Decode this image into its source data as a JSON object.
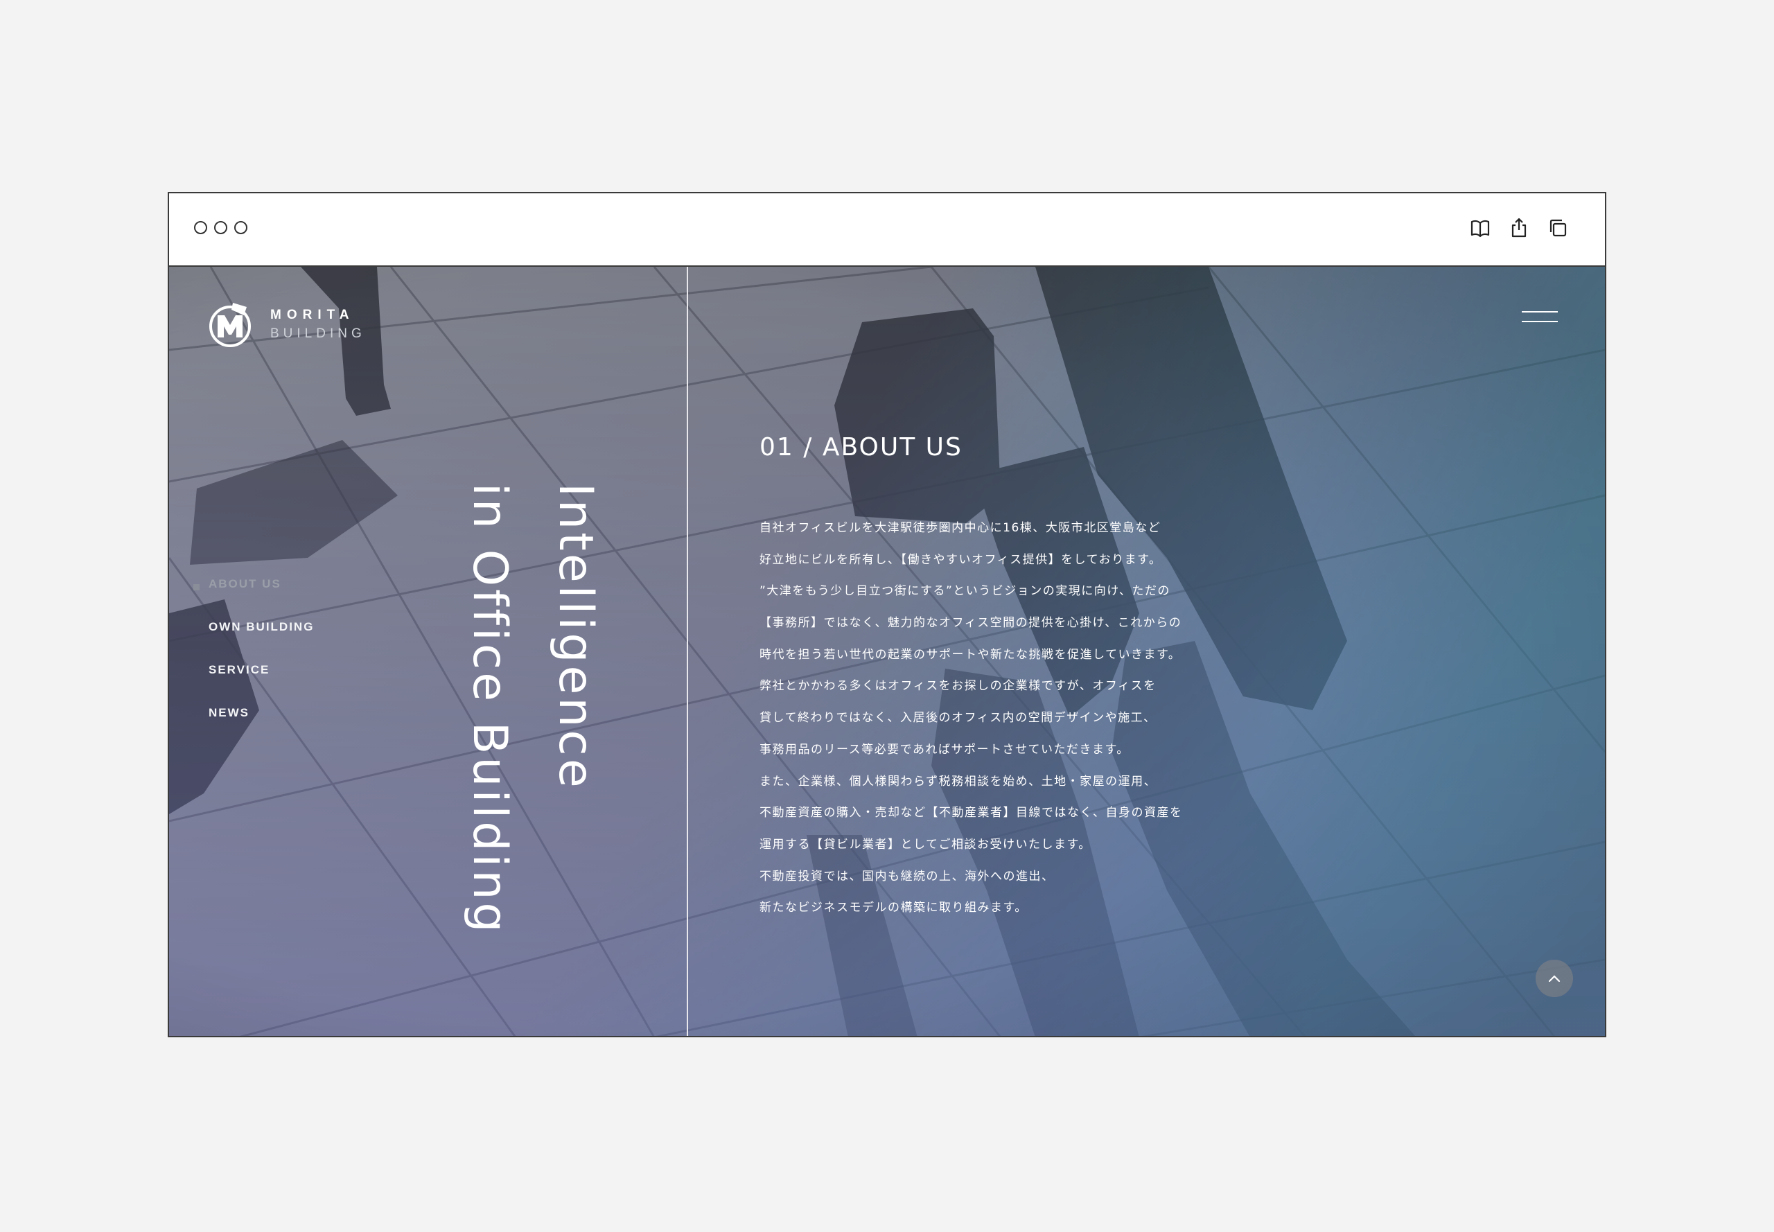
{
  "browser": {
    "icons": [
      "book-icon",
      "share-icon",
      "tabs-icon"
    ]
  },
  "brand": {
    "name_top": "MORITA",
    "name_bottom": "BUILDING"
  },
  "hero": {
    "title_line1": "Intelligence",
    "title_line2": "in Office Building"
  },
  "nav": {
    "items": [
      {
        "label": "ABOUT US",
        "active": true
      },
      {
        "label": "OWN BUILDING",
        "active": false
      },
      {
        "label": "SERVICE",
        "active": false
      },
      {
        "label": "NEWS",
        "active": false
      }
    ]
  },
  "about": {
    "heading": "01 / ABOUT US",
    "lines": [
      "自社オフィスビルを大津駅徒歩圏内中心に16棟、大阪市北区堂島など",
      "好立地にビルを所有し、【働きやすいオフィス提供】をしております。",
      "”大津をもう少し目立つ街にする”というビジョンの実現に向け、ただの",
      "【事務所】ではなく、魅力的なオフィス空間の提供を心掛け、これからの",
      "時代を担う若い世代の起業のサポートや新たな挑戦を促進していきます。",
      "弊社とかかわる多くはオフィスをお探しの企業様ですが、オフィスを",
      "貸して終わりではなく、入居後のオフィス内の空間デザインや施工、",
      "事務用品のリース等必要であればサポートさせていただきます。",
      "また、企業様、個人様関わらず税務相談を始め、土地・家屋の運用、",
      "不動産資産の購入・売却など【不動産業者】目線ではなく、自身の資産を",
      "運用する【貸ビル業者】としてご相談お受けいたします。",
      "不動産投資では、国内も継続の上、海外への進出、",
      "新たなビジネスモデルの構築に取り組みます。"
    ]
  },
  "colors": {
    "background": "#f3f3f3",
    "window_border": "#3a3a3a",
    "accent_teal": "#1f9aa8",
    "accent_violet": "#6b6fd0"
  }
}
